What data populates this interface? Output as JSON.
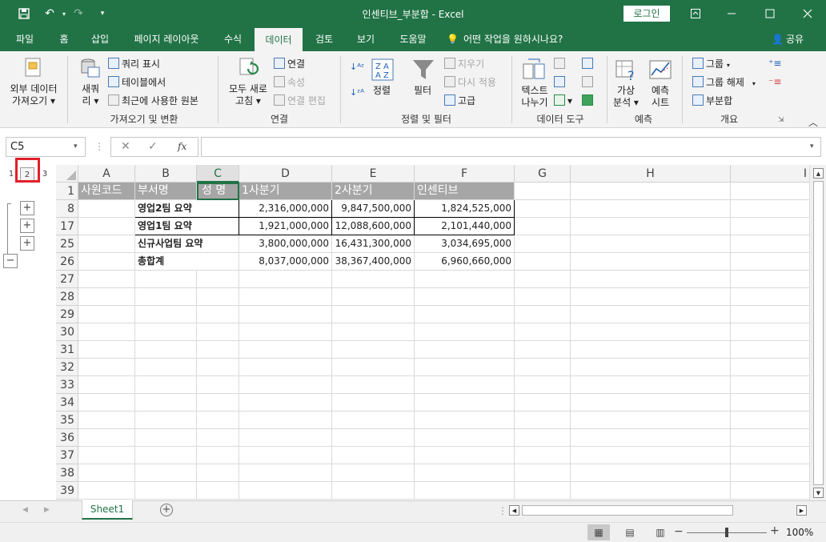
{
  "title_bar": {
    "title": "인센티브_부분합  -  Excel",
    "login": "로그인",
    "qat": {
      "save_icon": "floppy-disk-icon",
      "undo_icon": "undo-icon",
      "redo_icon": "redo-icon",
      "customize_icon": "chevron-down-icon"
    }
  },
  "tabs": [
    "파일",
    "홈",
    "삽입",
    "페이지 레이아웃",
    "수식",
    "데이터",
    "검토",
    "보기",
    "도움말"
  ],
  "active_tab": "데이터",
  "tell_me": "어떤 작업을 원하시나요?",
  "share": "공유",
  "ribbon": {
    "get_external_1": "외부 데이터",
    "get_external_2": "가져오기 ▾",
    "new_query_1": "새쿼",
    "new_query_2": "리 ▾",
    "show_queries": "쿼리 표시",
    "from_table": "테이블에서",
    "recent_sources": "최근에 사용한 원본",
    "group_get_transform": "가져오기 및 변환",
    "refresh_all_1": "모두 새로",
    "refresh_all_2": "고침 ▾",
    "connections": "연결",
    "properties": "속성",
    "edit_links": "연결 편집",
    "group_connections": "연결",
    "sort": "정렬",
    "filter": "필터",
    "clear": "지우기",
    "reapply": "다시 적용",
    "advanced": "고급",
    "group_sort_filter": "정렬 및 필터",
    "text_to_columns_1": "텍스트",
    "text_to_columns_2": "나누기",
    "group_data_tools": "데이터 도구",
    "what_if_1": "가상",
    "what_if_2": "분석 ▾",
    "forecast_1": "예측",
    "forecast_2": "시트",
    "group_forecast": "예측",
    "group_btn": "그룹",
    "ungroup": "그룹 해제",
    "subtotal": "부분합",
    "group_outline": "개요"
  },
  "formula_bar": {
    "name_box": "C5",
    "fx": "fx",
    "cancel_icon": "x-icon",
    "enter_icon": "check-icon",
    "value": ""
  },
  "outline": {
    "levels": [
      "1",
      "2",
      "3"
    ],
    "expand": "+",
    "collapse": "−"
  },
  "columns": [
    "A",
    "B",
    "C",
    "D",
    "E",
    "F",
    "G",
    "H",
    "I"
  ],
  "header_row": {
    "row": "1",
    "cells": [
      "사원코드",
      "부서명",
      "성  명",
      "1사분기",
      "2사분기",
      "인센티브"
    ]
  },
  "rows": [
    {
      "row": "8",
      "dept": "영업2팀 요약",
      "q1": "2,316,000,000",
      "q2": "9,847,500,000",
      "incentive": "1,824,525,000"
    },
    {
      "row": "17",
      "dept": "영업1팀 요약",
      "q1": "1,921,000,000",
      "q2": "12,088,600,000",
      "incentive": "2,101,440,000"
    },
    {
      "row": "25",
      "dept": "신규사업팀 요약",
      "q1": "3,800,000,000",
      "q2": "16,431,300,000",
      "incentive": "3,034,695,000"
    },
    {
      "row": "26",
      "dept": "총합계",
      "q1": "8,037,000,000",
      "q2": "38,367,400,000",
      "incentive": "6,960,660,000"
    }
  ],
  "empty_rows": [
    "27",
    "28",
    "29",
    "30",
    "31",
    "32",
    "33",
    "34",
    "35",
    "36",
    "37",
    "38",
    "39"
  ],
  "sheet_tab": "Sheet1",
  "add_sheet": "⊕",
  "status": {
    "zoom": "100%"
  },
  "colors": {
    "excel_green": "#217346",
    "header_fill": "#a6a6a6",
    "highlight": "#e0202a"
  }
}
